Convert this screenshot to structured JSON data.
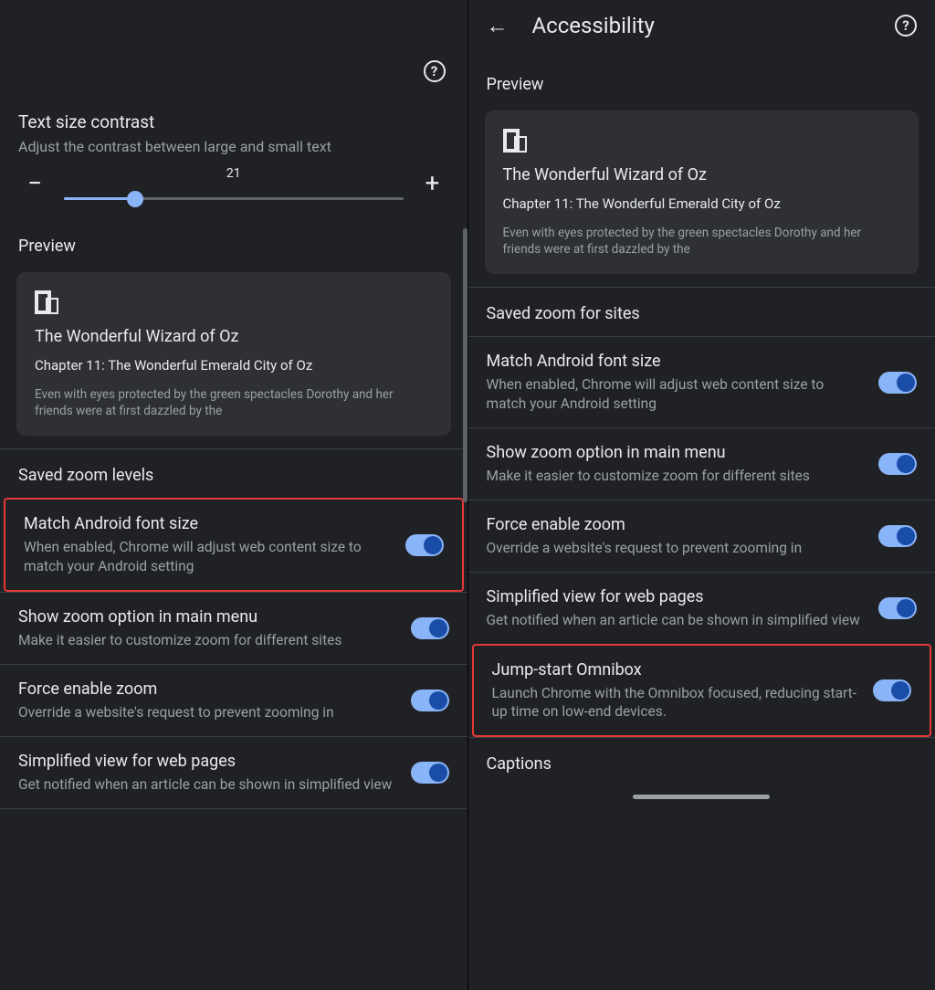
{
  "left": {
    "text_size_contrast": {
      "title": "Text size contrast",
      "subtitle": "Adjust the contrast between large and small text",
      "value": "21"
    },
    "preview": {
      "heading": "Preview",
      "book_title": "The Wonderful Wizard of Oz",
      "chapter": "Chapter 11: The Wonderful Emerald City of Oz",
      "body": "Even with eyes protected by the green spectacles Dorothy and her friends were at first dazzled by the"
    },
    "saved_zoom_heading": "Saved zoom levels",
    "rows": [
      {
        "title": "Match Android font size",
        "desc": "When enabled, Chrome will adjust web content size to match your Android setting"
      },
      {
        "title": "Show zoom option in main menu",
        "desc": "Make it easier to customize zoom for different sites"
      },
      {
        "title": "Force enable zoom",
        "desc": "Override a website's request to prevent zooming in"
      },
      {
        "title": "Simplified view for web pages",
        "desc": "Get notified when an article can be shown in simplified view"
      }
    ]
  },
  "right": {
    "page_title": "Accessibility",
    "preview": {
      "heading": "Preview",
      "book_title": "The Wonderful Wizard of Oz",
      "chapter": "Chapter 11: The Wonderful Emerald City of Oz",
      "body": "Even with eyes protected by the green spectacles Dorothy and her friends were at first dazzled by the"
    },
    "saved_zoom_heading": "Saved zoom for sites",
    "rows": [
      {
        "title": "Match Android font size",
        "desc": "When enabled, Chrome will adjust web content size to match your Android setting"
      },
      {
        "title": "Show zoom option in main menu",
        "desc": "Make it easier to customize zoom for different sites"
      },
      {
        "title": "Force enable zoom",
        "desc": "Override a website's request to prevent zooming in"
      },
      {
        "title": "Simplified view for web pages",
        "desc": "Get notified when an article can be shown in simplified view"
      },
      {
        "title": "Jump-start Omnibox",
        "desc": "Launch Chrome with the Omnibox focused, reducing start-up time on low-end devices."
      }
    ],
    "captions_heading": "Captions"
  },
  "glyphs": {
    "minus": "−",
    "plus": "+",
    "back": "←",
    "help": "?"
  }
}
